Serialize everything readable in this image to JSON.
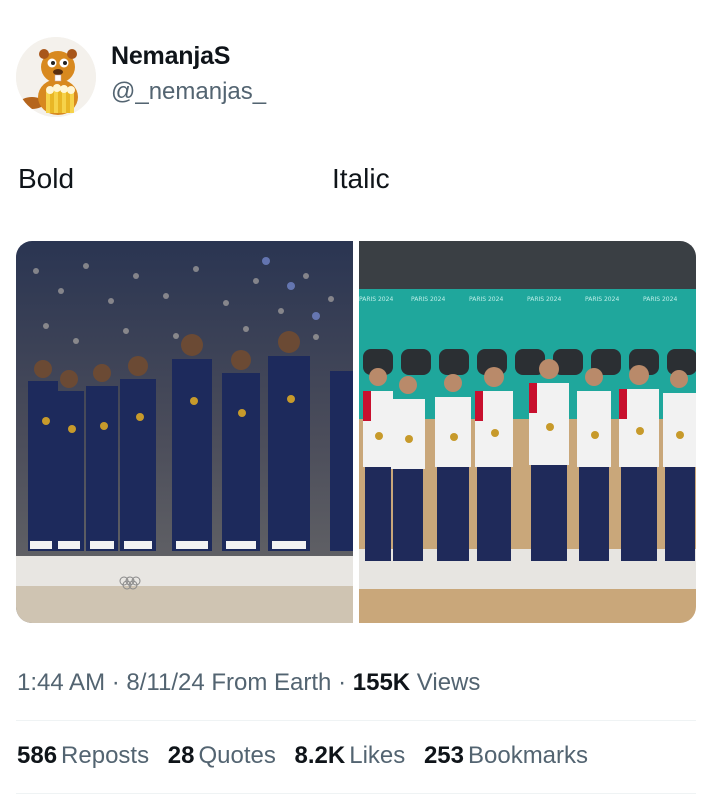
{
  "author": {
    "display_name": "NemanjaS",
    "handle": "@_nemanjas_",
    "avatar_icon": "cartoon-beaver-avatar"
  },
  "post": {
    "caption_left": "Bold",
    "caption_right": "Italic"
  },
  "media": {
    "left_image_desc_icon": "team-usa-medal-ceremony-photo",
    "right_image_desc_icon": "team-serbia-medal-ceremony-photo",
    "backdrop_text": "PARIS 2024"
  },
  "meta": {
    "time": "1:44 AM",
    "sep1": "·",
    "date": "8/11/24",
    "source": "From Earth",
    "sep2": "·",
    "views_count": "155K",
    "views_label": "Views"
  },
  "stats": {
    "reposts_count": "586",
    "reposts_label": "Reposts",
    "quotes_count": "28",
    "quotes_label": "Quotes",
    "likes_count": "8.2K",
    "likes_label": "Likes",
    "bookmarks_count": "253",
    "bookmarks_label": "Bookmarks"
  },
  "colors": {
    "text": "#0f1419",
    "secondary": "#536471",
    "usa_navy": "#1d2a5c",
    "serbia_white": "#f2f2f2",
    "teal_backdrop": "#1fa79c"
  }
}
